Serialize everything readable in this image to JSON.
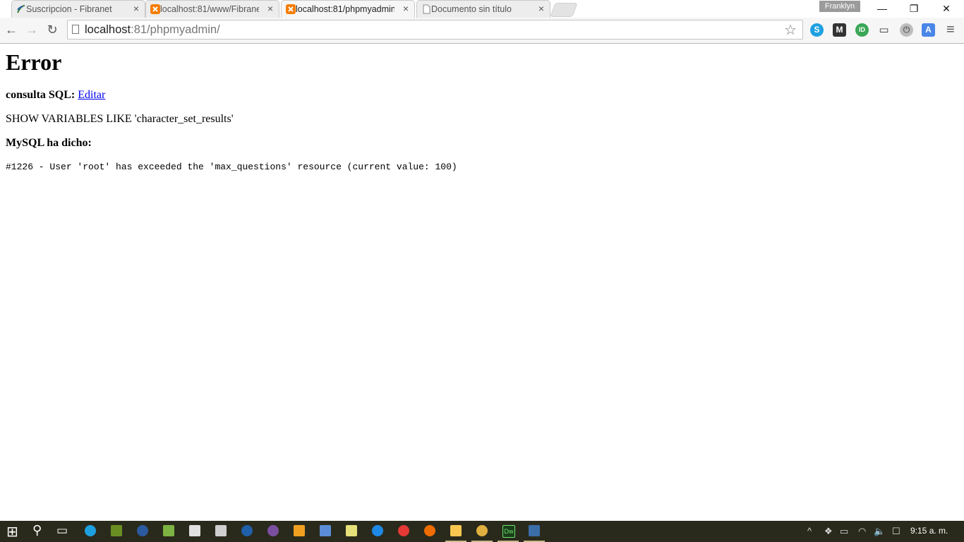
{
  "browser": {
    "tabs": [
      {
        "title": "Suscripcion - Fibranet",
        "favicon": "fibranet-icon",
        "active": false
      },
      {
        "title": "localhost:81/www/Fibrane",
        "favicon": "xampp-icon",
        "active": false
      },
      {
        "title": "localhost:81/phpmyadmin",
        "favicon": "xampp-icon",
        "active": true
      },
      {
        "title": "Documento sin título",
        "favicon": "document-icon",
        "active": false
      }
    ],
    "tab_close_glyph": "×",
    "profile_name": "Franklyn",
    "window_controls": {
      "minimize": "—",
      "restore": "❐",
      "close": "✕"
    },
    "nav": {
      "back": "←",
      "forward": "→",
      "reload": "↻"
    },
    "address": {
      "host": "localhost",
      "rest": ":81/phpmyadmin/"
    },
    "bookmark_star": "☆",
    "extensions": [
      {
        "name": "skype-icon",
        "color": "#1ea0e0",
        "glyph": "S"
      },
      {
        "name": "m-icon",
        "color": "#333333",
        "glyph": "M"
      },
      {
        "name": "green-ext-icon",
        "color": "#3aa757",
        "glyph": "ID"
      },
      {
        "name": "cast-icon",
        "color": "#f6f6f6",
        "glyph": "▭"
      },
      {
        "name": "power-icon",
        "color": "#9c9c9c",
        "glyph": "⏻"
      },
      {
        "name": "translate-icon",
        "color": "#4a86e8",
        "glyph": "A"
      }
    ],
    "menu_glyph": "≡"
  },
  "page": {
    "title": "Error",
    "query_label": "consulta SQL:",
    "edit_link": " Editar",
    "query": "SHOW VARIABLES LIKE 'character_set_results'",
    "mysql_label": "MySQL ha dicho:",
    "error": "#1226 - User 'root' has exceeded the 'max_questions' resource (current value: 100)"
  },
  "taskbar": {
    "start_glyph": "⊞",
    "search_glyph": "⚲",
    "taskview_glyph": "▭",
    "apps": [
      {
        "name": "skype-app-icon",
        "color": "#1ea0e0"
      },
      {
        "name": "people-app-icon",
        "color": "#6b8e23"
      },
      {
        "name": "eclipse-app-icon",
        "color": "#2c5aa0"
      },
      {
        "name": "android-app-icon",
        "color": "#7cb342"
      },
      {
        "name": "calculator-grid-icon",
        "color": "#e0e0e0"
      },
      {
        "name": "calculator-app-icon",
        "color": "#cfcfcf"
      },
      {
        "name": "globe-app-icon",
        "color": "#1f5fa8"
      },
      {
        "name": "purple-app-icon",
        "color": "#7b4fa0"
      },
      {
        "name": "media-app-icon",
        "color": "#f0a020"
      },
      {
        "name": "notes-app-icon",
        "color": "#5b8dd6"
      },
      {
        "name": "notepad-app-icon",
        "color": "#e6e07a"
      },
      {
        "name": "edge-app-icon",
        "color": "#1e88e5"
      },
      {
        "name": "opera-app-icon",
        "color": "#e53935"
      },
      {
        "name": "firefox-app-icon",
        "color": "#ef6c00"
      },
      {
        "name": "explorer-app-icon",
        "color": "#f9c74f"
      },
      {
        "name": "chrome-app-icon",
        "color": "#e0b040"
      },
      {
        "name": "dreamweaver-app-icon",
        "color": "#1a3d1a",
        "glyph": "Dw"
      },
      {
        "name": "workbench-app-icon",
        "color": "#3b6ea8"
      }
    ],
    "tray": {
      "chevron": "^",
      "dropbox": "❖",
      "battery": "▭",
      "wifi": "◠",
      "volume": "🔈",
      "notifications": "☐"
    },
    "clock": "9:15 a. m."
  }
}
